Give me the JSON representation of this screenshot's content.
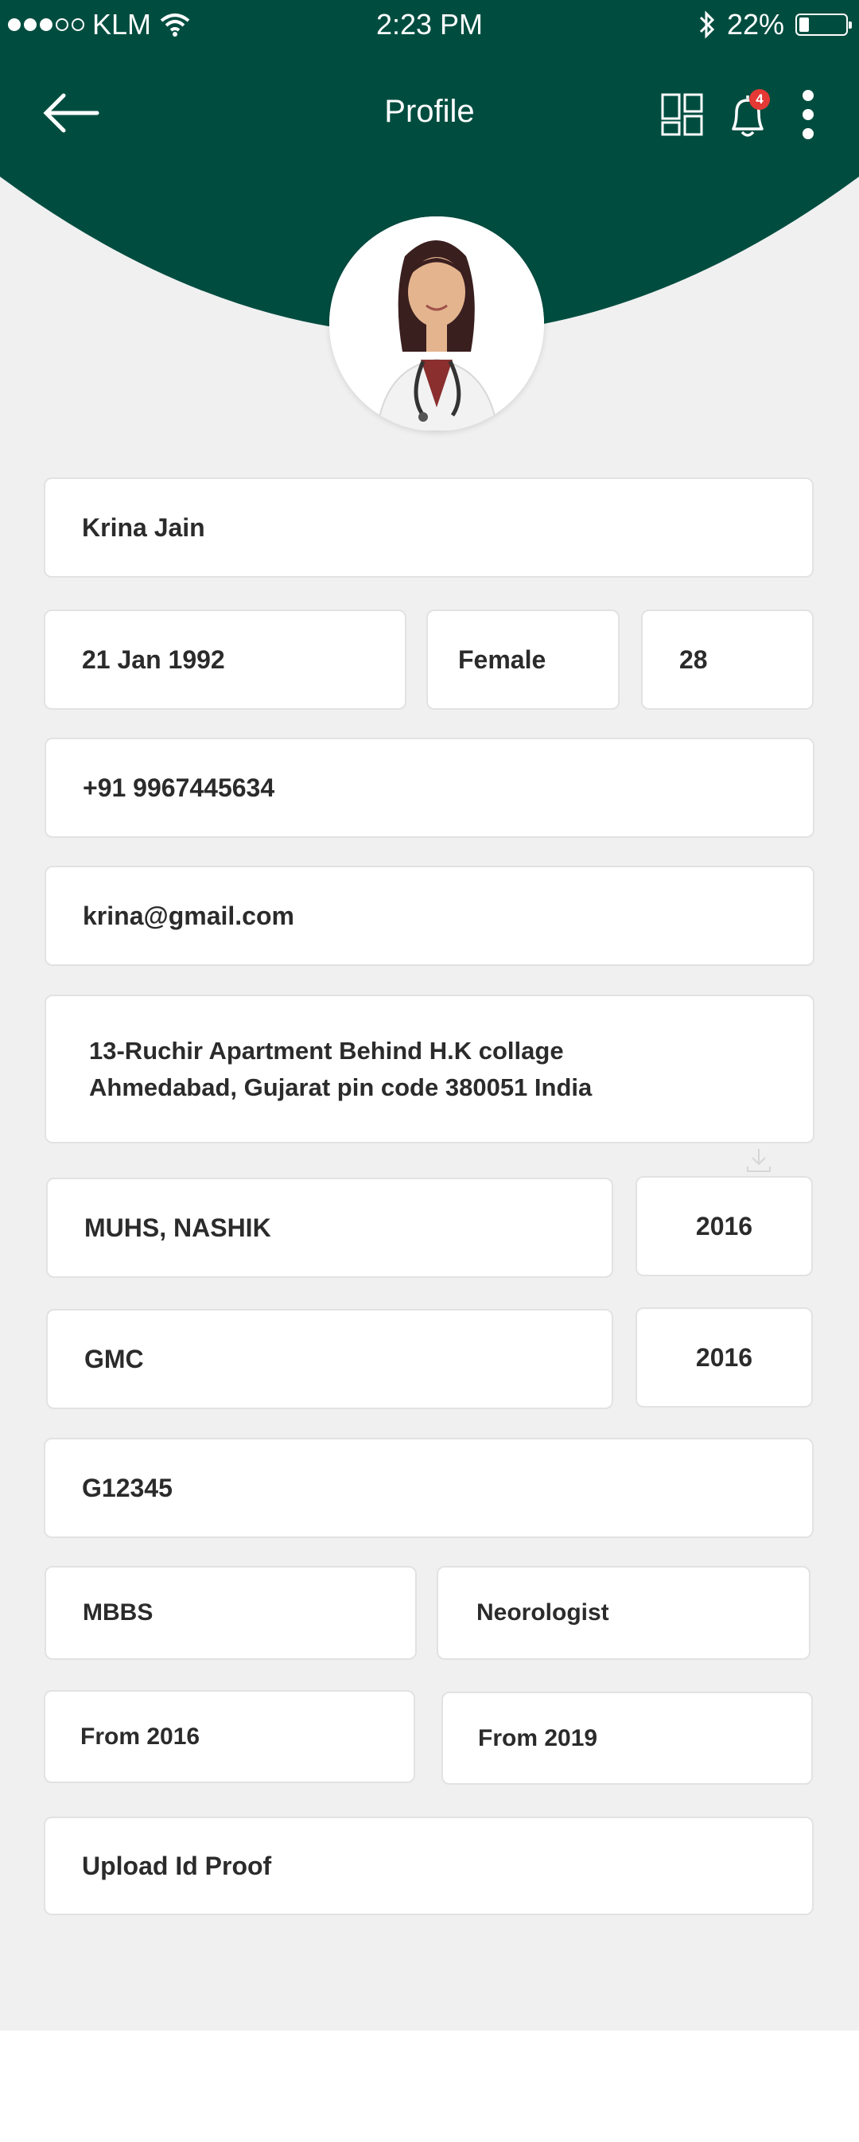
{
  "status_bar": {
    "carrier": "KLM",
    "time": "2:23 PM",
    "battery_percent": "22%",
    "battery_level": 0.22
  },
  "app_bar": {
    "title": "Profile",
    "notification_count": "4",
    "background_color": "#004d40"
  },
  "icons": {
    "back": "arrow-left-icon",
    "dashboard": "grid-icon",
    "notifications": "bell-icon",
    "more": "more-vertical-icon",
    "download": "download-icon"
  },
  "profile": {
    "name": "Krina Jain",
    "dob": "21 Jan 1992",
    "gender": "Female",
    "age": "28",
    "phone": "+91 9967445634",
    "email": "krina@gmail.com",
    "address_line1": "13-Ruchir Apartment Behind H.K collage",
    "address_line2": "Ahmedabad, Gujarat  pin code  380051  India",
    "university": "MUHS, NASHIK",
    "university_year": "2016",
    "council": "GMC",
    "council_year": "2016",
    "registration_no": "G12345",
    "degree": "MBBS",
    "specialization": "Neorologist",
    "degree_from": "From 2016",
    "specialization_from": "From 2019",
    "upload_id": "Upload Id Proof"
  }
}
